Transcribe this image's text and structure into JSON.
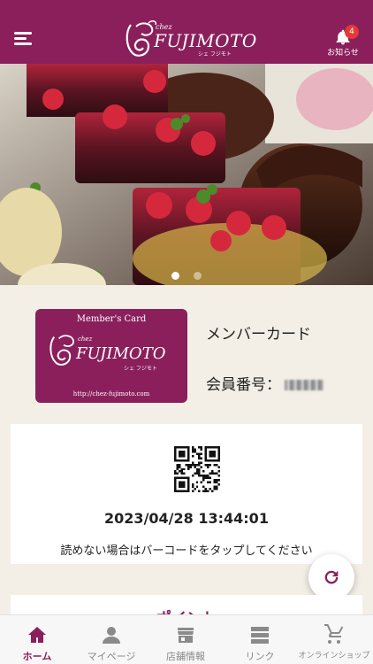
{
  "header": {
    "logo_chez": "chez",
    "logo_brand": "FUJIMOTO",
    "logo_kana": "シェ フジモト",
    "notice_label": "お知らせ",
    "notice_count": "4",
    "icons": {
      "menu": "hamburger-menu-icon",
      "notice": "bell-icon"
    }
  },
  "hero": {
    "description_icon": "cake-photo",
    "slides_total": 2,
    "active_slide": 1
  },
  "member": {
    "card": {
      "title": "Member's Card",
      "chez": "chez",
      "brand": "FUJIMOTO",
      "kana": "シェ フジモト",
      "url": "http://chez-fujimoto.com"
    },
    "label": "メンバーカード",
    "number_label": "会員番号："
  },
  "qr": {
    "timestamp": "2023/04/28 13:44:01",
    "hint": "読めない場合はバーコードをタップしてください"
  },
  "points": {
    "title": "ポイント"
  },
  "tabs": [
    {
      "label": "ホーム",
      "icon": "home-icon",
      "active": true
    },
    {
      "label": "マイページ",
      "icon": "person-icon",
      "active": false
    },
    {
      "label": "店舗情報",
      "icon": "store-icon",
      "active": false
    },
    {
      "label": "リンク",
      "icon": "list-icon",
      "active": false
    },
    {
      "label": "オンラインショップ",
      "icon": "cart-icon",
      "active": false
    }
  ],
  "colors": {
    "brand": "#8a1f5c",
    "background": "#f3efe6",
    "badge": "#e53935"
  }
}
